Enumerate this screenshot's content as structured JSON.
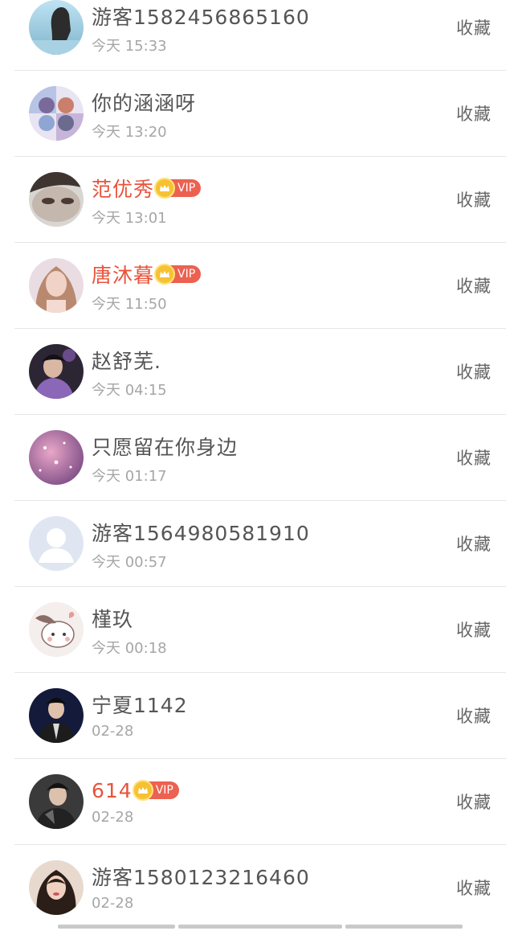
{
  "collect_label": "收藏",
  "vip_label": "VIP",
  "rows": [
    {
      "name": "游客1582456865160",
      "time": "今天 15:33",
      "vip": false
    },
    {
      "name": "你的涵涵呀",
      "time": "今天 13:20",
      "vip": false
    },
    {
      "name": "范优秀",
      "time": "今天 13:01",
      "vip": true
    },
    {
      "name": "唐沐暮",
      "time": "今天 11:50",
      "vip": true
    },
    {
      "name": "赵舒芜.",
      "time": "今天 04:15",
      "vip": false
    },
    {
      "name": "只愿留在你身边",
      "time": "今天 01:17",
      "vip": false
    },
    {
      "name": "游客1564980581910",
      "time": "今天 00:57",
      "vip": false
    },
    {
      "name": "槿玖",
      "time": "今天 00:18",
      "vip": false
    },
    {
      "name": "宁夏1142",
      "time": "02-28",
      "vip": false
    },
    {
      "name": "614",
      "time": "02-28",
      "vip": true
    },
    {
      "name": "游客1580123216460",
      "time": "02-28",
      "vip": false
    }
  ],
  "colors": {
    "vip_name": "#e8533c",
    "vip_badge": "#ec6151",
    "crown": "#f6c234",
    "divider": "#e6e6e6"
  }
}
